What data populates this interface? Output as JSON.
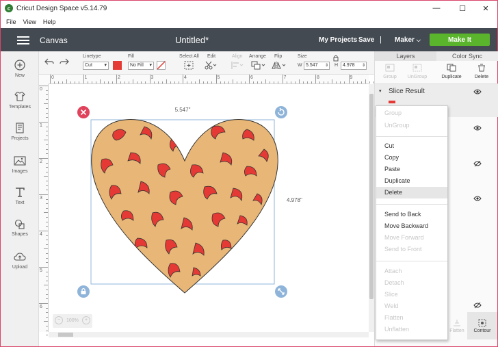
{
  "window": {
    "title": "Cricut Design Space  v5.14.79",
    "logo_letter": "c",
    "minimize": "—",
    "maximize": "☐",
    "close": "✕"
  },
  "menu": [
    "File",
    "View",
    "Help"
  ],
  "appbar": {
    "section": "Canvas",
    "doc_title": "Untitled*",
    "my_projects": "My Projects",
    "save": "Save",
    "separator": "|",
    "machine": "Maker",
    "make_it": "Make It",
    "make_it_color": "#5ab52c",
    "bar_color": "#434a52"
  },
  "toolbar": {
    "linetype_label": "Linetype",
    "linetype_value": "Cut",
    "fill_label": "Fill",
    "fill_value": "No Fill",
    "linetype_color": "#e53935",
    "select_all": "Select All",
    "edit": "Edit",
    "align": "Align",
    "arrange": "Arrange",
    "flip": "Flip",
    "size": "Size",
    "w_label": "W",
    "w_value": "5.547",
    "h_label": "H",
    "h_value": "4.978"
  },
  "sidebar": [
    {
      "label": "New",
      "icon": "plus-circle-icon"
    },
    {
      "label": "Templates",
      "icon": "tshirt-icon"
    },
    {
      "label": "Projects",
      "icon": "projects-icon"
    },
    {
      "label": "Images",
      "icon": "image-icon"
    },
    {
      "label": "Text",
      "icon": "text-icon"
    },
    {
      "label": "Shapes",
      "icon": "shapes-icon"
    },
    {
      "label": "Upload",
      "icon": "upload-cloud-icon"
    }
  ],
  "rulers": {
    "h_ticks": [
      "0",
      "1",
      "2",
      "3",
      "4",
      "5",
      "6",
      "7",
      "8",
      "9"
    ],
    "v_ticks": [
      "0",
      "1",
      "2",
      "3",
      "4",
      "5",
      "6"
    ]
  },
  "canvas": {
    "width_label": "5.547\"",
    "height_label": "4.978\"",
    "heart_fill": "#e8b676",
    "spot_fill": "#e53935",
    "zoom_value": "100%",
    "zoom_minus": "−",
    "zoom_plus": "+"
  },
  "panel": {
    "tabs": [
      "Layers",
      "Color Sync"
    ],
    "tools": [
      {
        "label": "Group",
        "enabled": false
      },
      {
        "label": "UnGroup",
        "enabled": false
      },
      {
        "label": "Duplicate",
        "enabled": true
      },
      {
        "label": "Delete",
        "enabled": true
      }
    ],
    "layer_title": "Slice Result",
    "flatten": "Flatten",
    "contour": "Contour"
  },
  "context_menu": [
    {
      "label": "Group",
      "enabled": false
    },
    {
      "label": "UnGroup",
      "enabled": false
    },
    {
      "label": "Cut",
      "enabled": true
    },
    {
      "label": "Copy",
      "enabled": true
    },
    {
      "label": "Paste",
      "enabled": true
    },
    {
      "label": "Duplicate",
      "enabled": true
    },
    {
      "label": "Delete",
      "enabled": true,
      "highlighted": true
    },
    {
      "label": "Send to Back",
      "enabled": true
    },
    {
      "label": "Move Backward",
      "enabled": true
    },
    {
      "label": "Move Forward",
      "enabled": false
    },
    {
      "label": "Send to Front",
      "enabled": false
    },
    {
      "label": "Attach",
      "enabled": false
    },
    {
      "label": "Detach",
      "enabled": false
    },
    {
      "label": "Slice",
      "enabled": false
    },
    {
      "label": "Weld",
      "enabled": false
    },
    {
      "label": "Flatten",
      "enabled": false
    },
    {
      "label": "Unflatten",
      "enabled": false
    }
  ]
}
